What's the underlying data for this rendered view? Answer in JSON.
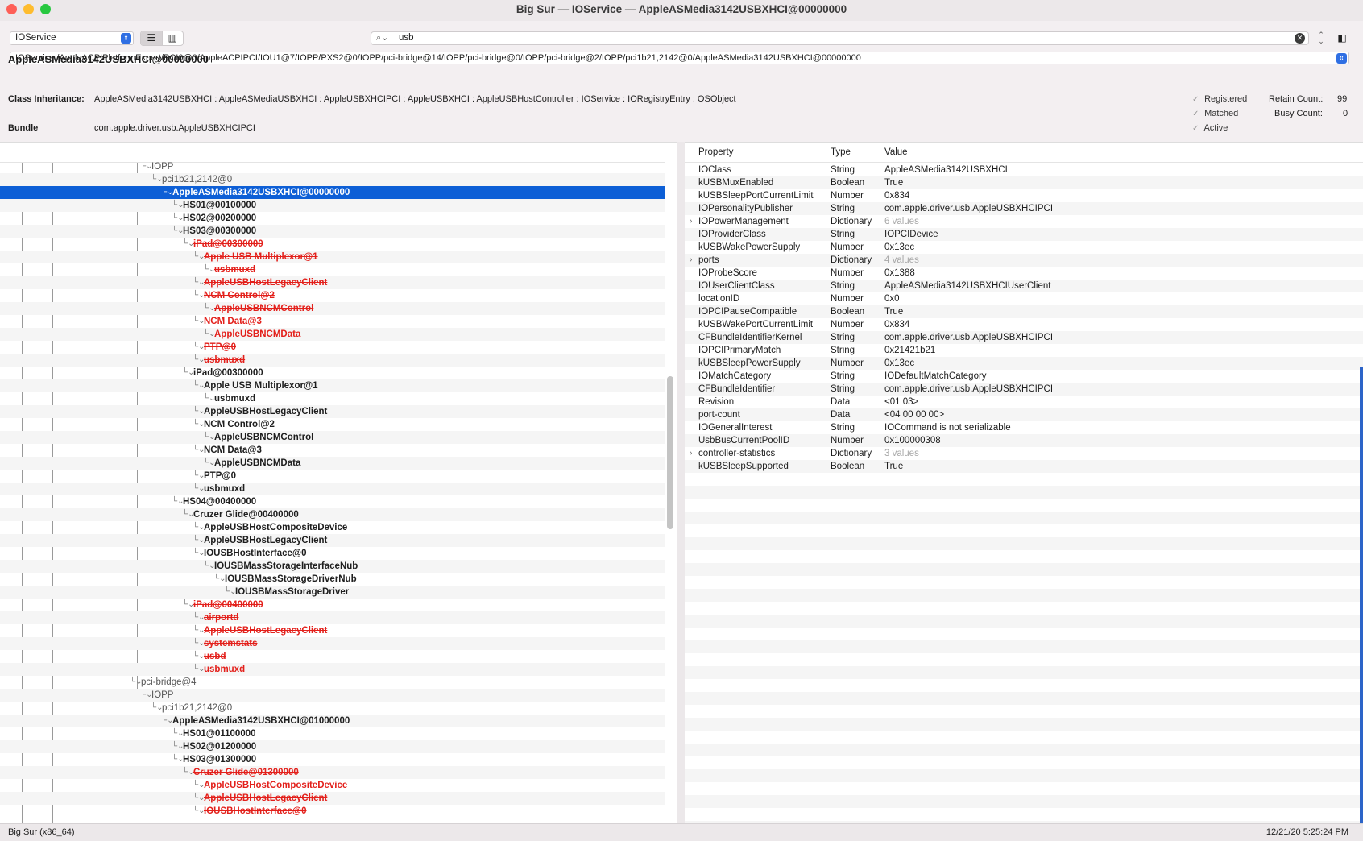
{
  "window": {
    "title": "Big Sur — IOService — AppleASMedia3142USBXHCI@00000000"
  },
  "toolbar": {
    "plane": "IOService",
    "search_value": "usb",
    "path": "IOService:/AppleACPIPlatformExpert/PCI0@0/AppleACPIPCI/IOU1@7/IOPP/PXS2@0/IOPP/pci-bridge@14/IOPP/pci-bridge@0/IOPP/pci-bridge@2/IOPP/pci1b21,2142@0/AppleASMedia3142USBXHCI@00000000"
  },
  "header": {
    "object_name": "AppleASMedia3142USBXHCI@00000000",
    "class_label": "Class Inheritance:",
    "class_value": "AppleASMedia3142USBXHCI : AppleASMediaUSBXHCI : AppleUSBXHCIPCI : AppleUSBXHCI : AppleUSBHostController : IOService : IORegistryEntry : OSObject",
    "bundle_label": "Bundle",
    "bundle_value": "com.apple.driver.usb.AppleUSBXHCIPCI",
    "registered": "Registered",
    "matched": "Matched",
    "active": "Active",
    "retain_label": "Retain Count:",
    "retain_value": "99",
    "busy_label": "Busy Count:",
    "busy_value": "0"
  },
  "tree": [
    {
      "d": 5,
      "label": "IOPP",
      "s": "plain"
    },
    {
      "d": 6,
      "label": "pci1b21,2142@0",
      "s": "plain"
    },
    {
      "d": 7,
      "label": "AppleASMedia3142USBXHCI@00000000",
      "s": "sel"
    },
    {
      "d": 8,
      "label": "HS01@00100000",
      "s": "hl"
    },
    {
      "d": 8,
      "label": "HS02@00200000",
      "s": "hl"
    },
    {
      "d": 8,
      "label": "HS03@00300000",
      "s": "hl"
    },
    {
      "d": 9,
      "label": "iPad@00300000",
      "s": "gone"
    },
    {
      "d": 10,
      "label": "Apple USB Multiplexor@1",
      "s": "gone"
    },
    {
      "d": 11,
      "label": "usbmuxd",
      "s": "gone"
    },
    {
      "d": 10,
      "label": "AppleUSBHostLegacyClient",
      "s": "gone"
    },
    {
      "d": 10,
      "label": "NCM Control@2",
      "s": "gone"
    },
    {
      "d": 11,
      "label": "AppleUSBNCMControl",
      "s": "gone"
    },
    {
      "d": 10,
      "label": "NCM Data@3",
      "s": "gone"
    },
    {
      "d": 11,
      "label": "AppleUSBNCMData",
      "s": "gone"
    },
    {
      "d": 10,
      "label": "PTP@0",
      "s": "gone"
    },
    {
      "d": 10,
      "label": "usbmuxd",
      "s": "gone"
    },
    {
      "d": 9,
      "label": "iPad@00300000",
      "s": "hl"
    },
    {
      "d": 10,
      "label": "Apple USB Multiplexor@1",
      "s": "hl"
    },
    {
      "d": 11,
      "label": "usbmuxd",
      "s": "hl"
    },
    {
      "d": 10,
      "label": "AppleUSBHostLegacyClient",
      "s": "hl"
    },
    {
      "d": 10,
      "label": "NCM Control@2",
      "s": "hl"
    },
    {
      "d": 11,
      "label": "AppleUSBNCMControl",
      "s": "hl"
    },
    {
      "d": 10,
      "label": "NCM Data@3",
      "s": "hl"
    },
    {
      "d": 11,
      "label": "AppleUSBNCMData",
      "s": "hl"
    },
    {
      "d": 10,
      "label": "PTP@0",
      "s": "hl"
    },
    {
      "d": 10,
      "label": "usbmuxd",
      "s": "hl"
    },
    {
      "d": 8,
      "label": "HS04@00400000",
      "s": "hl"
    },
    {
      "d": 9,
      "label": "Cruzer Glide@00400000",
      "s": "hl"
    },
    {
      "d": 10,
      "label": "AppleUSBHostCompositeDevice",
      "s": "hl"
    },
    {
      "d": 10,
      "label": "AppleUSBHostLegacyClient",
      "s": "hl"
    },
    {
      "d": 10,
      "label": "IOUSBHostInterface@0",
      "s": "hl"
    },
    {
      "d": 11,
      "label": "IOUSBMassStorageInterfaceNub",
      "s": "hl"
    },
    {
      "d": 12,
      "label": "IOUSBMassStorageDriverNub",
      "s": "hl"
    },
    {
      "d": 13,
      "label": "IOUSBMassStorageDriver",
      "s": "hl"
    },
    {
      "d": 9,
      "label": "iPad@00400000",
      "s": "gone"
    },
    {
      "d": 10,
      "label": "airportd",
      "s": "gone"
    },
    {
      "d": 10,
      "label": "AppleUSBHostLegacyClient",
      "s": "gone"
    },
    {
      "d": 10,
      "label": "systemstats",
      "s": "gone"
    },
    {
      "d": 10,
      "label": "usbd",
      "s": "gone"
    },
    {
      "d": 10,
      "label": "usbmuxd",
      "s": "gone"
    },
    {
      "d": 4,
      "label": "pci-bridge@4",
      "s": "plain"
    },
    {
      "d": 5,
      "label": "IOPP",
      "s": "plain"
    },
    {
      "d": 6,
      "label": "pci1b21,2142@0",
      "s": "plain"
    },
    {
      "d": 7,
      "label": "AppleASMedia3142USBXHCI@01000000",
      "s": "hl"
    },
    {
      "d": 8,
      "label": "HS01@01100000",
      "s": "hl"
    },
    {
      "d": 8,
      "label": "HS02@01200000",
      "s": "hl"
    },
    {
      "d": 8,
      "label": "HS03@01300000",
      "s": "hl"
    },
    {
      "d": 9,
      "label": "Cruzer Glide@01300000",
      "s": "gone"
    },
    {
      "d": 10,
      "label": "AppleUSBHostCompositeDevice",
      "s": "gone"
    },
    {
      "d": 10,
      "label": "AppleUSBHostLegacyClient",
      "s": "gone"
    },
    {
      "d": 10,
      "label": "IOUSBHostInterface@0",
      "s": "gone"
    }
  ],
  "props": {
    "col_property": "Property",
    "col_type": "Type",
    "col_value": "Value",
    "rows": [
      {
        "k": "IOClass",
        "t": "String",
        "v": "AppleASMedia3142USBXHCI"
      },
      {
        "k": "kUSBMuxEnabled",
        "t": "Boolean",
        "v": "True"
      },
      {
        "k": "kUSBSleepPortCurrentLimit",
        "t": "Number",
        "v": "0x834"
      },
      {
        "k": "IOPersonalityPublisher",
        "t": "String",
        "v": "com.apple.driver.usb.AppleUSBXHCIPCI"
      },
      {
        "k": "IOPowerManagement",
        "t": "Dictionary",
        "v": "6 values",
        "x": true
      },
      {
        "k": "IOProviderClass",
        "t": "String",
        "v": "IOPCIDevice"
      },
      {
        "k": "kUSBWakePowerSupply",
        "t": "Number",
        "v": "0x13ec"
      },
      {
        "k": "ports",
        "t": "Dictionary",
        "v": "4 values",
        "x": true
      },
      {
        "k": "IOProbeScore",
        "t": "Number",
        "v": "0x1388"
      },
      {
        "k": "IOUserClientClass",
        "t": "String",
        "v": "AppleASMedia3142USBXHCIUserClient"
      },
      {
        "k": "locationID",
        "t": "Number",
        "v": "0x0"
      },
      {
        "k": "IOPCIPauseCompatible",
        "t": "Boolean",
        "v": "True"
      },
      {
        "k": "kUSBWakePortCurrentLimit",
        "t": "Number",
        "v": "0x834"
      },
      {
        "k": "CFBundleIdentifierKernel",
        "t": "String",
        "v": "com.apple.driver.usb.AppleUSBXHCIPCI"
      },
      {
        "k": "IOPCIPrimaryMatch",
        "t": "String",
        "v": "0x21421b21"
      },
      {
        "k": "kUSBSleepPowerSupply",
        "t": "Number",
        "v": "0x13ec"
      },
      {
        "k": "IOMatchCategory",
        "t": "String",
        "v": "IODefaultMatchCategory"
      },
      {
        "k": "CFBundleIdentifier",
        "t": "String",
        "v": "com.apple.driver.usb.AppleUSBXHCIPCI"
      },
      {
        "k": "Revision",
        "t": "Data",
        "v": "<01 03>"
      },
      {
        "k": "port-count",
        "t": "Data",
        "v": "<04 00 00 00>"
      },
      {
        "k": "IOGeneralInterest",
        "t": "String",
        "v": "IOCommand is not serializable"
      },
      {
        "k": "UsbBusCurrentPoolID",
        "t": "Number",
        "v": "0x100000308"
      },
      {
        "k": "controller-statistics",
        "t": "Dictionary",
        "v": "3 values",
        "x": true
      },
      {
        "k": "kUSBSleepSupported",
        "t": "Boolean",
        "v": "True"
      }
    ]
  },
  "status": {
    "left": "Big Sur (x86_64)",
    "right": "12/21/20 5:25:24 PM"
  },
  "colors": {
    "selection": "#0d5fd6",
    "removed": "#e3201b",
    "accent": "#2f6fe3"
  },
  "icons": [
    "close-icon",
    "minimize-icon",
    "zoom-icon",
    "search-icon",
    "clear-icon",
    "list-view-icon",
    "column-view-icon",
    "disclosure-icon"
  ]
}
